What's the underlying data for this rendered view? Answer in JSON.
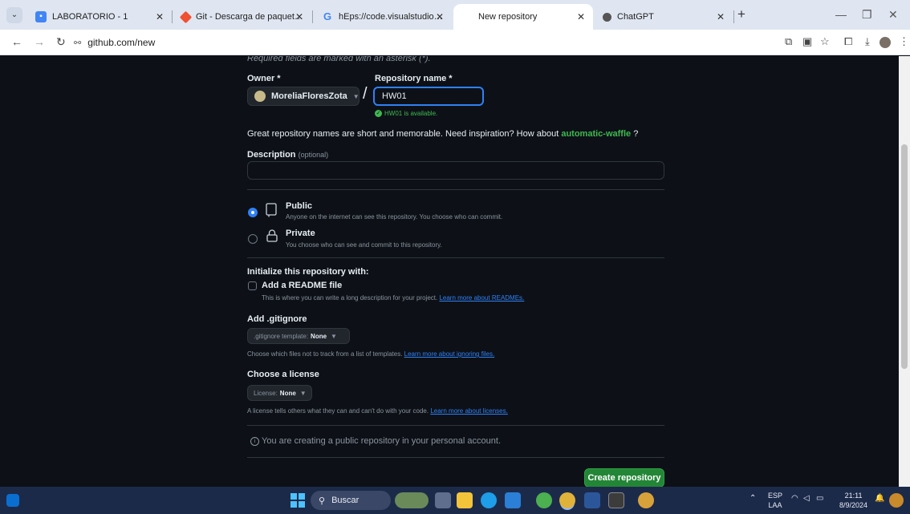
{
  "browser": {
    "tabs": [
      {
        "title": "LABORATORIO - 1",
        "fav": "LAB",
        "fav_color": "#4285f4"
      },
      {
        "title": "Git - Descarga de paquetes",
        "fav": "git",
        "fav_color": "#f05133"
      },
      {
        "title": "hEps://code.visualstudio.com/D",
        "fav": "G",
        "fav_color": "#ffffff"
      },
      {
        "title": "New repository",
        "fav": "",
        "fav_color": "#ffffff"
      },
      {
        "title": "ChatGPT",
        "fav": "",
        "fav_color": "#555555"
      }
    ],
    "url": "github.com/new"
  },
  "form": {
    "required_note": "Required fields are marked with an asterisk (*).",
    "owner_label": "Owner *",
    "owner_value": "MoreliaFloresZota",
    "repo_label": "Repository name *",
    "repo_value": "HW01",
    "availability": "HW01 is available.",
    "hint_text": "Great repository names are short and memorable. Need inspiration? How about",
    "hint_suggestion": "automatic-waffle",
    "hint_end": "?",
    "description_label": "Description",
    "description_optional": "(optional)",
    "public_title": "Public",
    "public_desc": "Anyone on the internet can see this repository. You choose who can commit.",
    "private_title": "Private",
    "private_desc": "You choose who can see and commit to this repository.",
    "init_title": "Initialize this repository with:",
    "readme_label": "Add a README file",
    "readme_desc": "This is where you can write a long description for your project.",
    "readme_link": "Learn more about READMEs.",
    "gitignore_title": "Add .gitignore",
    "gitignore_select_prefix": ".gitignore template:",
    "gitignore_select_value": "None",
    "gitignore_desc": "Choose which files not to track from a list of templates.",
    "gitignore_link": "Learn more about ignoring files.",
    "license_title": "Choose a license",
    "license_select_prefix": "License:",
    "license_select_value": "None",
    "license_desc": "A license tells others what they can and can't do with your code.",
    "license_link": "Learn more about licenses.",
    "notice": "You are creating a public repository in your personal account.",
    "create_button": "Create repository"
  },
  "taskbar": {
    "search_label": "Buscar",
    "lang_1": "ESP",
    "lang_2": "LAA",
    "time": "21:11",
    "date": "8/9/2024"
  },
  "colors": {
    "page_bg": "#0d1117",
    "accent_blue": "#2f81f7",
    "success_green": "#3fb950",
    "button_green": "#238636"
  }
}
